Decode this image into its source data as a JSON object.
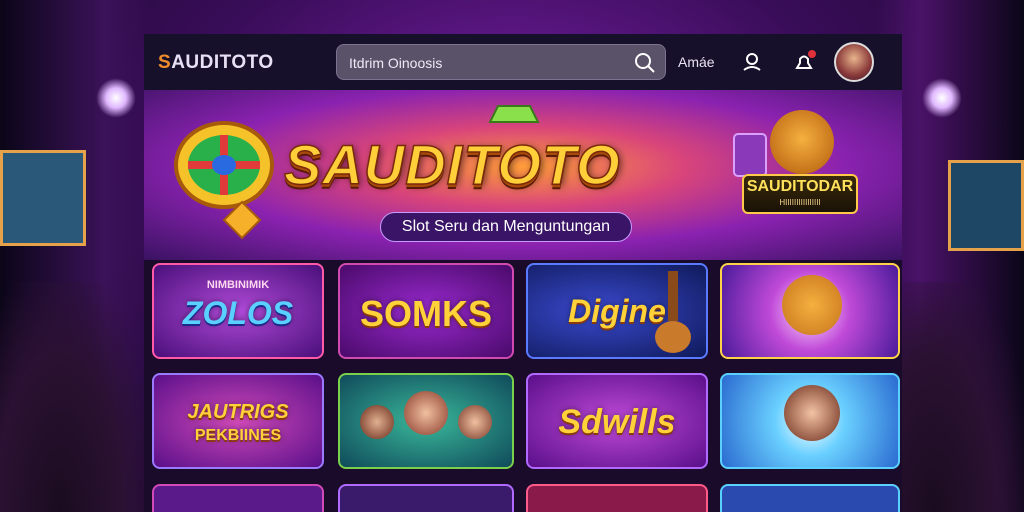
{
  "header": {
    "logo_text": "SAUDITOTO",
    "search_value": "Itdrim Oinoosis",
    "label": "Amáe"
  },
  "hero": {
    "title": "SAUDITOTO",
    "tagline": "Slot Seru dan Menguntungan",
    "badge_title": "SAUDITODAR",
    "badge_subtitle": "HIIIIIIIIIIIIIIII"
  },
  "games": [
    {
      "top": "NIMBINIMIK",
      "title": "ZOLOS"
    },
    {
      "title": "SOMKS"
    },
    {
      "title": "Digine"
    },
    {
      "title": ""
    },
    {
      "title": "JAUTRIGS",
      "sub": "PEKBIINES"
    },
    {
      "title": ""
    },
    {
      "title": "Sdwills"
    },
    {
      "title": ""
    }
  ],
  "colors": {
    "accent": "#ffcf3a",
    "brand_s": "#f08c2c",
    "notification": "#e0303a"
  },
  "icons": [
    "search-icon",
    "user-icon",
    "bell-icon",
    "avatar"
  ]
}
